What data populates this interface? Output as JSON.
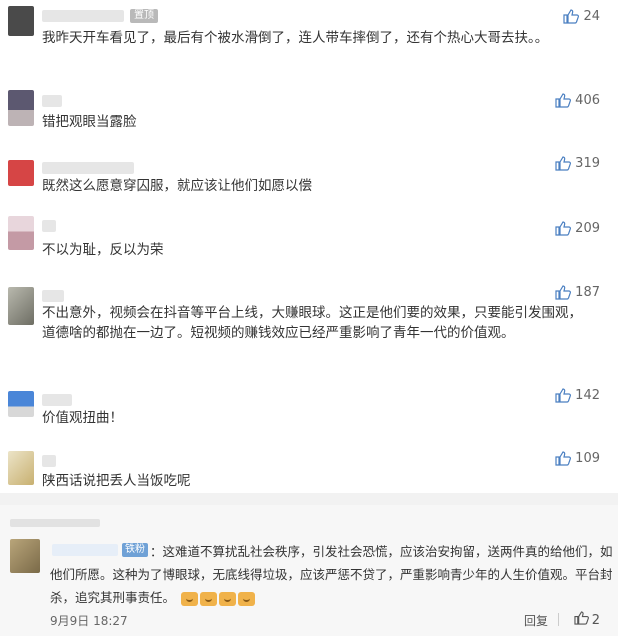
{
  "comments": [
    {
      "text": "我昨天开车看见了，最后有个被水滑倒了，连人带车摔倒了，还有个热心大哥去扶。。",
      "likes": "24",
      "avatar_color": "#4a4a4a",
      "badge": "置顶"
    },
    {
      "text": "错把观眼当露脸",
      "likes": "406",
      "avatar_color": "#5c5870"
    },
    {
      "text": "既然这么愿意穿囚服，就应该让他们如愿以偿",
      "likes": "319",
      "avatar_color": "#d64545"
    },
    {
      "text": "不以为耻，反以为荣",
      "likes": "209",
      "avatar_color": "#c49aa5"
    },
    {
      "text": "不出意外，视频会在抖音等平台上线，大赚眼球。这正是他们要的效果，只要能引发围观，道德啥的都抛在一边了。短视频的赚钱效应已经严重影响了青年一代的价值观。",
      "likes": "187",
      "avatar_color": "#8a8a80"
    },
    {
      "text": "价值观扭曲！",
      "likes": "142",
      "avatar_color": "#4a86d8"
    },
    {
      "text": "陕西话说把丢人当饭吃呢",
      "likes": "109",
      "avatar_color": "#c8b070"
    }
  ],
  "reply_block": {
    "tag": "铁粉",
    "text": "：这难道不算扰乱社会秩序，引发社会恐慌，应该治安拘留，送两件真的给他们，如他们所愿。这种为了博眼球，无底线得垃圾，应该严惩不贷了，严重影响青少年的人生价值观。平台封杀，追究其刑事责任。",
    "emoji_count": 4,
    "time": "9月9日 18:27",
    "reply_label": "回复",
    "likes": "2",
    "avatar_color": "#7a6a48"
  }
}
